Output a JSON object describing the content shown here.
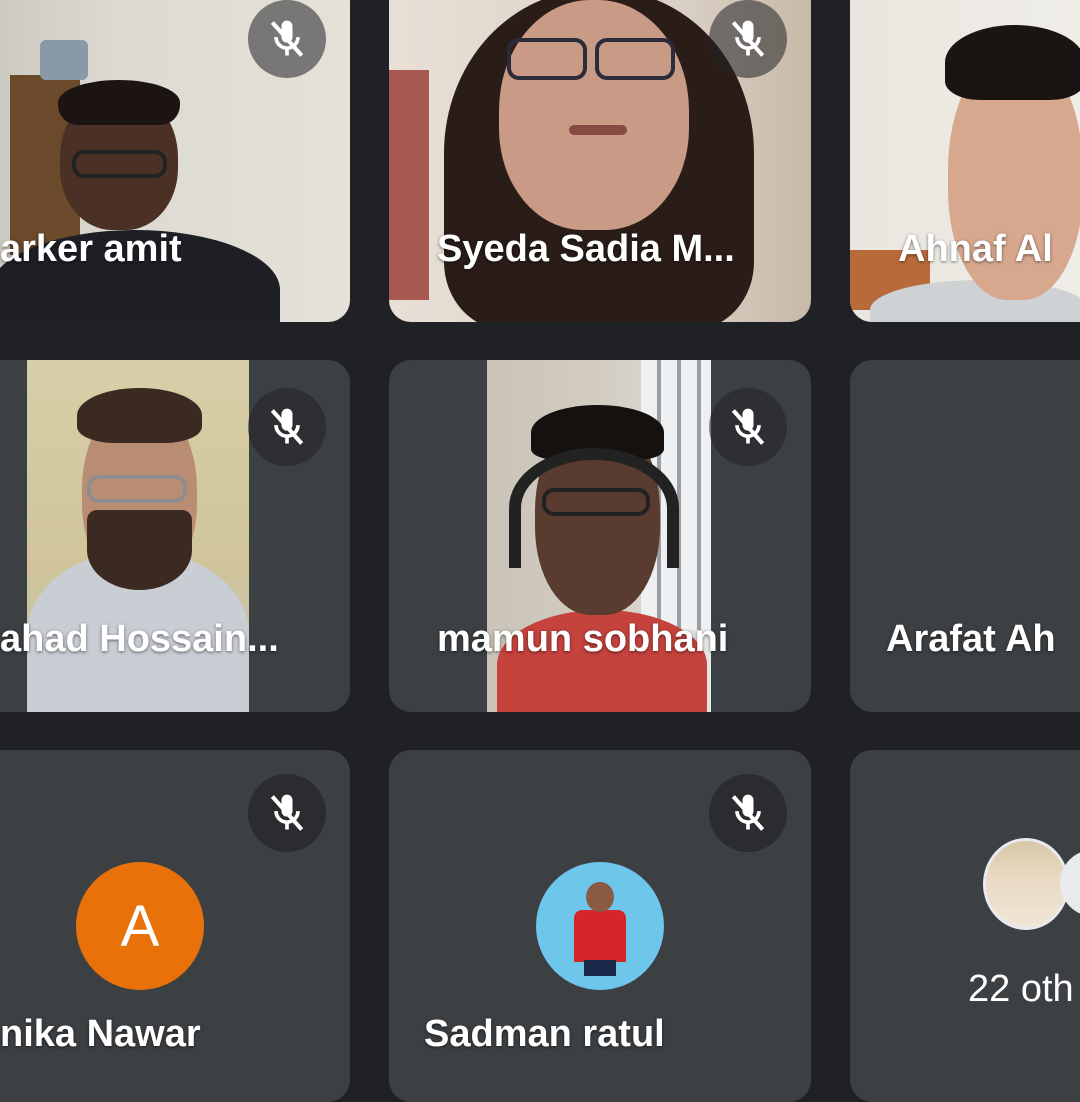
{
  "participants": [
    {
      "name": "arker amit",
      "muted": true
    },
    {
      "name": "Syeda Sadia M...",
      "muted": true
    },
    {
      "name": "Ahnaf Al",
      "muted": false
    },
    {
      "name": "ahad Hossain...",
      "muted": true
    },
    {
      "name": "mamun sobhani",
      "muted": true
    },
    {
      "name": "Arafat Ah",
      "muted": false
    },
    {
      "name": "nika Nawar",
      "muted": true,
      "avatar_letter": "A",
      "avatar_color": "#e8710a"
    },
    {
      "name": "Sadman ratul",
      "muted": true
    },
    {
      "others_label": "22 oth"
    }
  ],
  "icons": {
    "mic_off": "mic-off-icon",
    "pin": "pin-icon"
  },
  "colors": {
    "background": "#202124",
    "tile": "#3c4043",
    "avatar_orange": "#e8710a"
  }
}
